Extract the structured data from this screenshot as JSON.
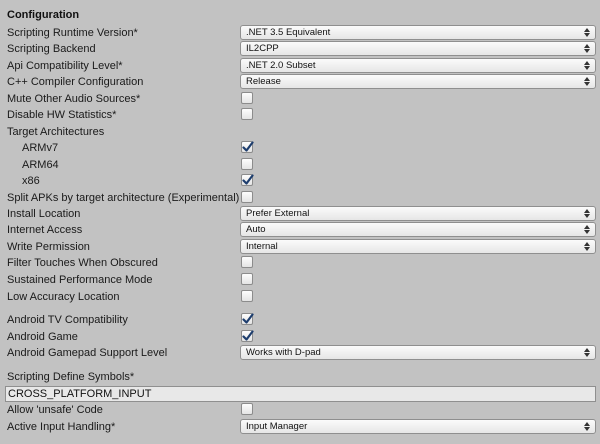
{
  "section_title": "Configuration",
  "rows": {
    "scripting_runtime_version": {
      "label": "Scripting Runtime Version*",
      "value": ".NET 3.5 Equivalent"
    },
    "scripting_backend": {
      "label": "Scripting Backend",
      "value": "IL2CPP"
    },
    "api_compatibility_level": {
      "label": "Api Compatibility Level*",
      "value": ".NET 2.0 Subset"
    },
    "cpp_compiler_configuration": {
      "label": "C++ Compiler Configuration",
      "value": "Release"
    },
    "mute_other_audio_sources": {
      "label": "Mute Other Audio Sources*",
      "checked": false
    },
    "disable_hw_statistics": {
      "label": "Disable HW Statistics*",
      "checked": false
    },
    "target_architectures": {
      "label": "Target Architectures"
    },
    "armv7": {
      "label": "ARMv7",
      "checked": true
    },
    "arm64": {
      "label": "ARM64",
      "checked": false
    },
    "x86": {
      "label": "x86",
      "checked": true
    },
    "split_apks": {
      "label": "Split APKs by target architecture (Experimental)",
      "checked": false
    },
    "install_location": {
      "label": "Install Location",
      "value": "Prefer External"
    },
    "internet_access": {
      "label": "Internet Access",
      "value": "Auto"
    },
    "write_permission": {
      "label": "Write Permission",
      "value": "Internal"
    },
    "filter_touches": {
      "label": "Filter Touches When Obscured",
      "checked": false
    },
    "sustained_performance": {
      "label": "Sustained Performance Mode",
      "checked": false
    },
    "low_accuracy_location": {
      "label": "Low Accuracy Location",
      "checked": false
    },
    "android_tv": {
      "label": "Android TV Compatibility",
      "checked": true
    },
    "android_game": {
      "label": "Android Game",
      "checked": true
    },
    "gamepad_support": {
      "label": "Android Gamepad Support Level",
      "value": "Works with D-pad"
    },
    "scripting_define_symbols": {
      "label": "Scripting Define Symbols*",
      "value": "CROSS_PLATFORM_INPUT"
    },
    "allow_unsafe": {
      "label": "Allow 'unsafe' Code",
      "checked": false
    },
    "active_input_handling": {
      "label": "Active Input Handling*",
      "value": "Input Manager"
    }
  },
  "colors": {
    "background": "#c2c2c2",
    "checkmark": "#1e3e6e"
  }
}
